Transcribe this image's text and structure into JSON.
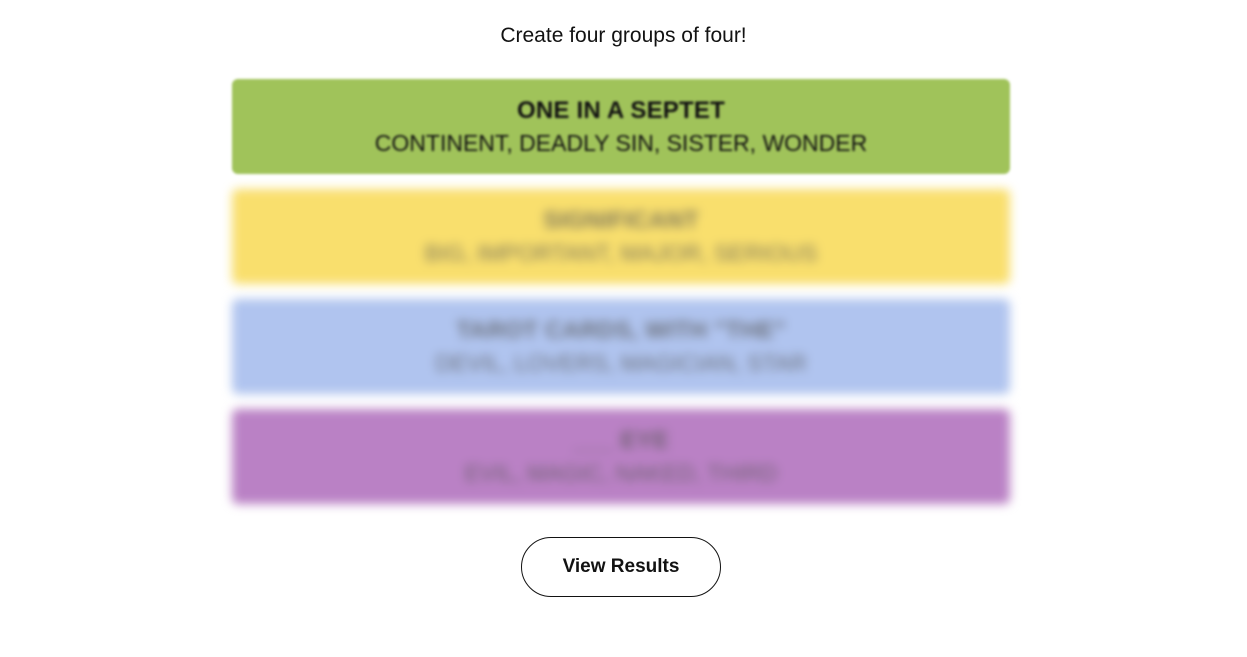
{
  "header": {
    "instructions": "Create four groups of four!"
  },
  "groups": [
    {
      "title": "ONE IN A SEPTET",
      "members": "CONTINENT, DEADLY SIN, SISTER, WONDER",
      "color": "#a0c35a"
    },
    {
      "title": "SIGNIFICANT",
      "members": "BIG, IMPORTANT, MAJOR, SERIOUS",
      "color": "#f9df6d"
    },
    {
      "title": "TAROT CARDS, WITH \"THE\"",
      "members": "DEVIL, LOVERS, MAGICIAN, STAR",
      "color": "#b0c4ef"
    },
    {
      "title": "___ EYE",
      "members": "EVIL, MAGIC, NAKED, THIRD",
      "color": "#ba81c5"
    }
  ],
  "actions": {
    "view_results_label": "View Results"
  }
}
